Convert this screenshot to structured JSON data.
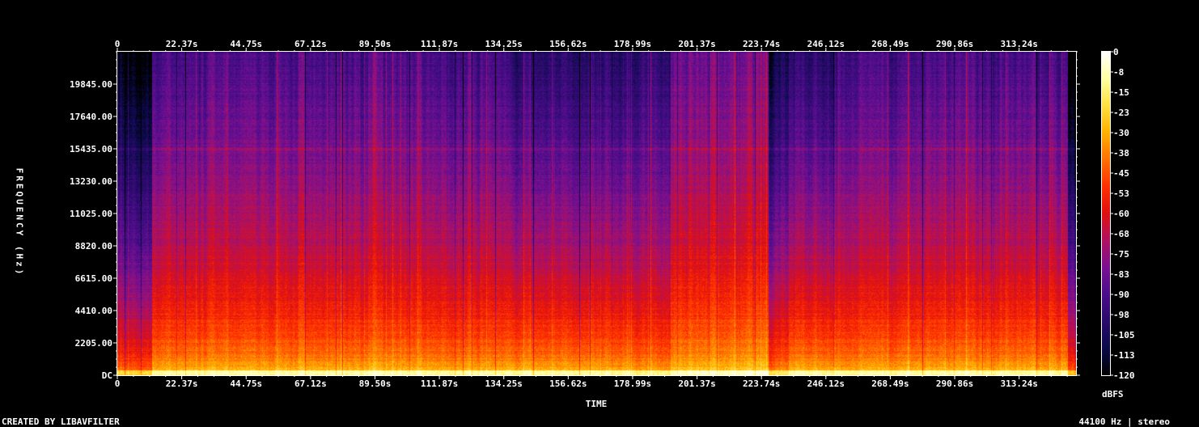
{
  "chart_data": {
    "type": "heatmap",
    "title": "",
    "xlabel": "TIME",
    "ylabel": "FREQUENCY (Hz)",
    "x_ticks": [
      "0",
      "22.37s",
      "44.75s",
      "67.12s",
      "89.50s",
      "111.87s",
      "134.25s",
      "156.62s",
      "178.99s",
      "201.37s",
      "223.74s",
      "246.12s",
      "268.49s",
      "290.86s",
      "313.24s"
    ],
    "x_tick_values": [
      0,
      22.37,
      44.75,
      67.12,
      89.5,
      111.87,
      134.25,
      156.62,
      178.99,
      201.37,
      223.74,
      246.12,
      268.49,
      290.86,
      313.24
    ],
    "xlim": [
      0,
      333
    ],
    "y_ticks": [
      "DC",
      "2205.00",
      "4410.00",
      "6615.00",
      "8820.00",
      "11025.00",
      "13230.00",
      "15435.00",
      "17640.00",
      "19845.00"
    ],
    "y_tick_values": [
      0,
      2205,
      4410,
      6615,
      8820,
      11025,
      13230,
      15435,
      17640,
      19845
    ],
    "ylim": [
      0,
      22050
    ],
    "colorbar": {
      "label": "dBFS",
      "ticks": [
        "0",
        "-8",
        "-15",
        "-23",
        "-30",
        "-38",
        "-45",
        "-53",
        "-60",
        "-68",
        "-75",
        "-83",
        "-90",
        "-98",
        "-105",
        "-113",
        "-120"
      ],
      "range": [
        -120,
        0
      ],
      "colormap": [
        "#000000",
        "#0a0a4a",
        "#2a0a6a",
        "#4a0d8a",
        "#7a1090",
        "#b01060",
        "#e01010",
        "#ff3000",
        "#ff7000",
        "#ffb000",
        "#ffe040",
        "#ffffa0",
        "#ffffff"
      ]
    },
    "approx_levels_by_band_dbfs": [
      {
        "band": "0-1000 Hz",
        "level": -25
      },
      {
        "band": "1000-4400 Hz",
        "level": -50
      },
      {
        "band": "4400-8800 Hz",
        "level": -62
      },
      {
        "band": "8800-13200 Hz",
        "level": -75
      },
      {
        "band": "13200-22050 Hz",
        "level": -88
      }
    ]
  },
  "footer": {
    "left": "CREATED BY LIBAVFILTER",
    "right": "44100 Hz | stereo"
  }
}
